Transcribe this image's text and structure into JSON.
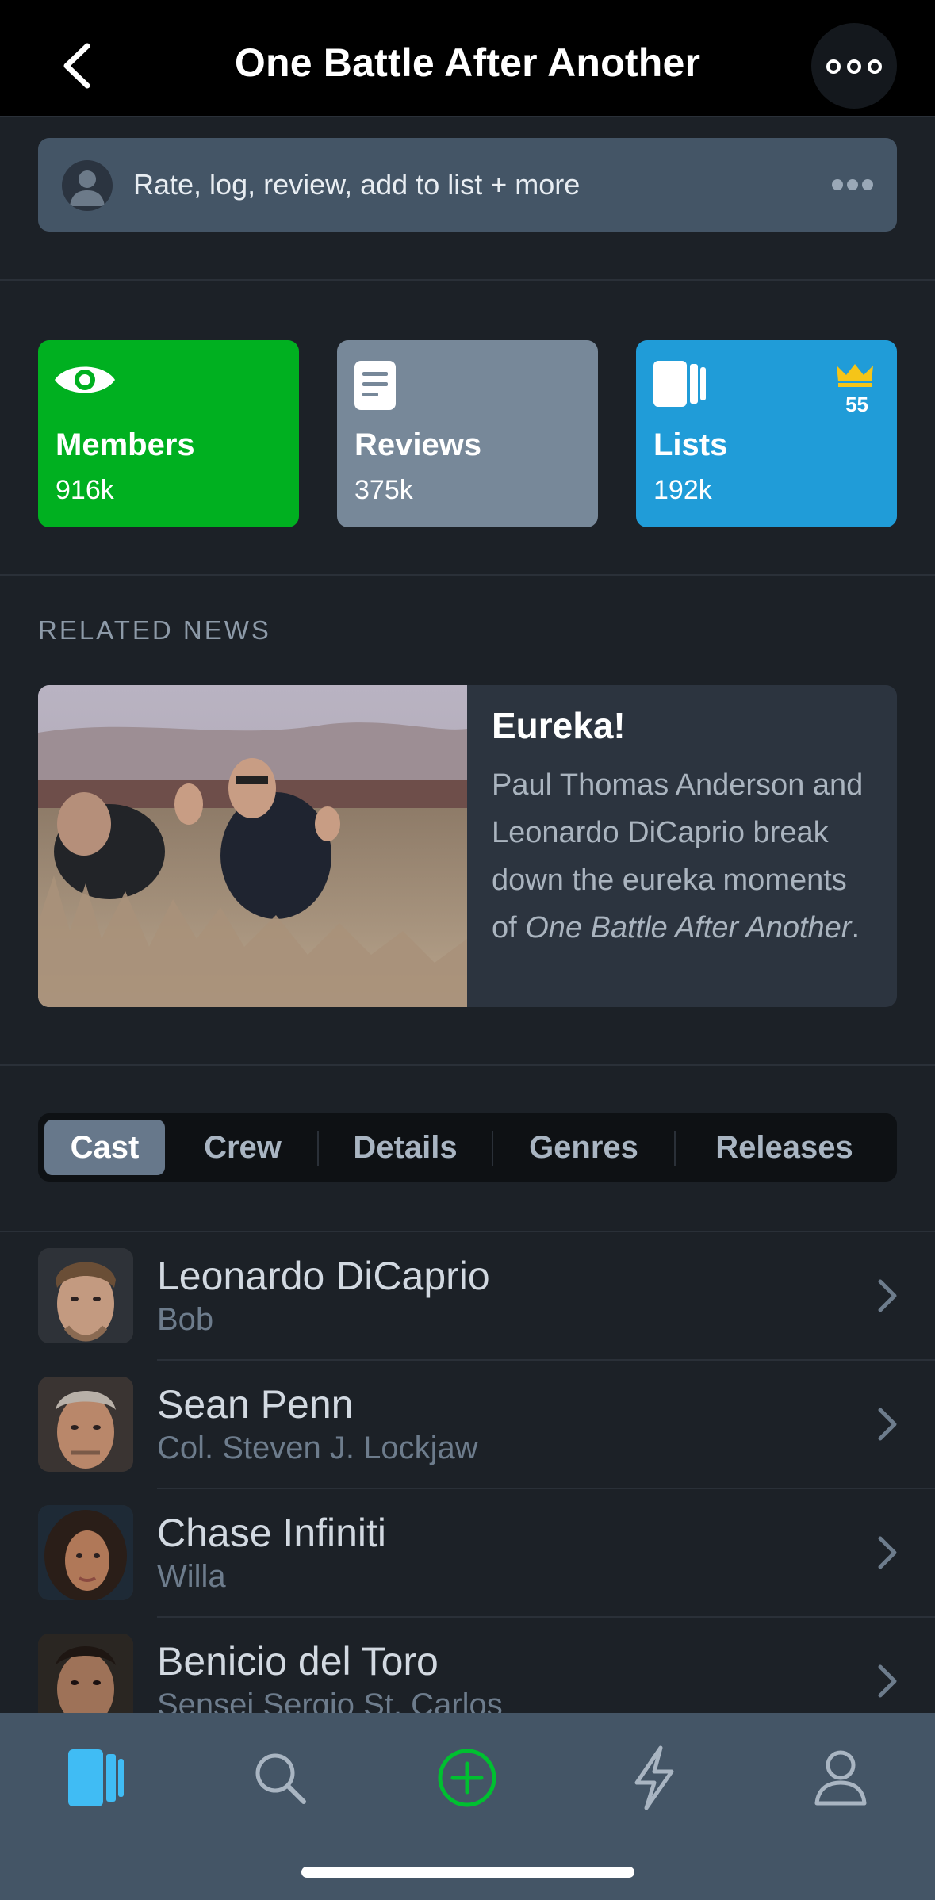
{
  "header": {
    "title": "One Battle After Another"
  },
  "rate_bar": {
    "text": "Rate, log, review, add to list + more"
  },
  "stats": {
    "members": {
      "label": "Members",
      "value": "916k",
      "color": "#00b020"
    },
    "reviews": {
      "label": "Reviews",
      "value": "375k",
      "color": "#778899"
    },
    "lists": {
      "label": "Lists",
      "value": "192k",
      "color": "#209cd8",
      "badge_count": "55"
    }
  },
  "related_news": {
    "heading": "RELATED NEWS",
    "title": "Eureka!",
    "body_prefix": "Paul Thomas Anderson and Leonardo DiCaprio break down the eureka moments of ",
    "body_italic": "One Battle After Another",
    "body_suffix": "."
  },
  "tabs": [
    "Cast",
    "Crew",
    "Details",
    "Genres",
    "Releases"
  ],
  "active_tab": "Cast",
  "cast": [
    {
      "name": "Leonardo DiCaprio",
      "role": "Bob"
    },
    {
      "name": "Sean Penn",
      "role": "Col. Steven J. Lockjaw"
    },
    {
      "name": "Chase Infiniti",
      "role": "Willa"
    },
    {
      "name": "Benicio del Toro",
      "role": "Sensei Sergio St. Carlos"
    }
  ],
  "bottom_nav": {
    "items": [
      "films-icon",
      "search-icon",
      "add-icon",
      "activity-icon",
      "profile-icon"
    ],
    "active_color": "#40bcf4",
    "add_color": "#00c030"
  }
}
